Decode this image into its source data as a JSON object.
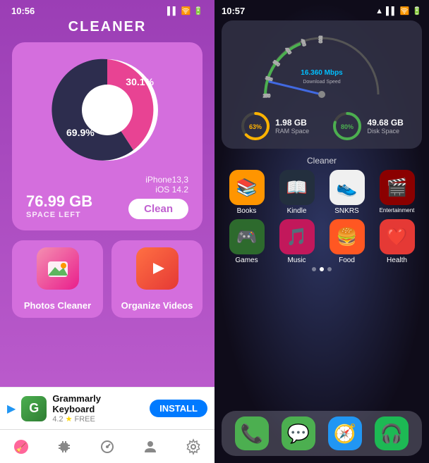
{
  "left": {
    "status_time": "10:56",
    "title": "CLEANER",
    "chart": {
      "percent_used": "30.1%",
      "percent_free": "69.9%"
    },
    "space_gb": "76.99 GB",
    "space_label": "SPACE LEFT",
    "device_model": "iPhone13,3",
    "device_os": "iOS 14.2",
    "clean_button": "Clean",
    "tiles": [
      {
        "label": "Photos Cleaner",
        "icon_type": "photos"
      },
      {
        "label": "Organize Videos",
        "icon_type": "videos"
      }
    ],
    "ad": {
      "name": "Grammarly Keyboard",
      "rating": "4.2",
      "price": "FREE",
      "install_label": "INSTALL"
    },
    "tabs": [
      {
        "name": "cleaner-tab",
        "icon": "🧹",
        "active": true
      },
      {
        "name": "cpu-tab",
        "icon": "⚙️",
        "active": false
      },
      {
        "name": "speed-tab",
        "icon": "⏱️",
        "active": false
      },
      {
        "name": "contacts-tab",
        "icon": "👤",
        "active": false
      },
      {
        "name": "settings-tab",
        "icon": "⚙️",
        "active": false
      }
    ]
  },
  "right": {
    "status_time": "10:57",
    "widget": {
      "speed_value": "16.360 Mbps",
      "speed_label": "Download Speed",
      "ram_percent": "63%",
      "ram_label": "RAM Space",
      "ram_gb": "1.98 GB",
      "disk_percent": "80%",
      "disk_label": "Disk Space",
      "disk_gb": "49.68 GB",
      "cleaner_label": "Cleaner"
    },
    "app_rows": [
      [
        {
          "name": "Books",
          "label": "Books",
          "color": "#FF9500",
          "emoji": "📚"
        },
        {
          "name": "Kindle",
          "label": "Kindle",
          "color": "#232F3E",
          "emoji": "📖"
        },
        {
          "name": "SNKRS",
          "label": "SNKRS",
          "color": "#e0e0e0",
          "emoji": "👟"
        },
        {
          "name": "Entertainment",
          "label": "Entertainment",
          "color": "#8B0000",
          "emoji": "🎬"
        }
      ],
      [
        {
          "name": "Games",
          "label": "Games",
          "color": "#4CAF50",
          "emoji": "🎮"
        },
        {
          "name": "Music",
          "label": "Music",
          "color": "#e91e8c",
          "emoji": "🎵"
        },
        {
          "name": "Food",
          "label": "Food",
          "color": "#FF5722",
          "emoji": "🍔"
        },
        {
          "name": "Health",
          "label": "Health",
          "color": "#F44336",
          "emoji": "❤️"
        }
      ]
    ],
    "dock": [
      {
        "name": "Phone",
        "color": "#4CAF50",
        "emoji": "📞"
      },
      {
        "name": "Messages",
        "color": "#4CAF50",
        "emoji": "💬"
      },
      {
        "name": "Safari",
        "color": "#2196F3",
        "emoji": "🧭"
      },
      {
        "name": "Spotify",
        "color": "#1DB954",
        "emoji": "🎧"
      }
    ]
  }
}
